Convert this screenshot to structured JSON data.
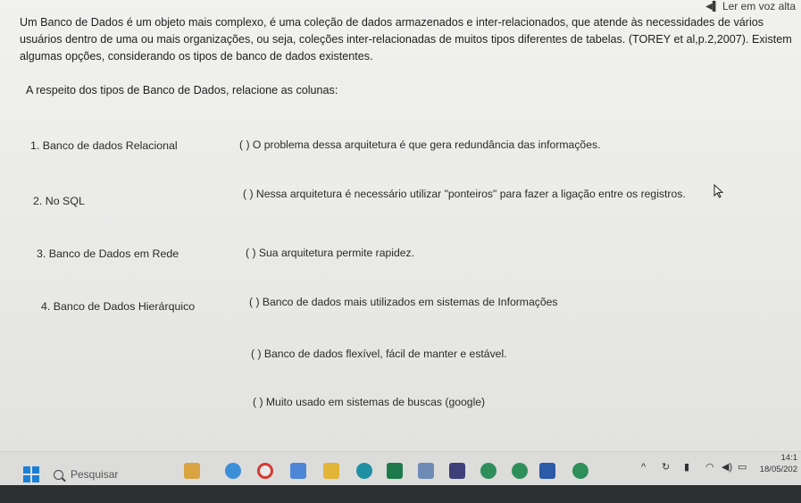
{
  "toolbar": {
    "read_aloud": "Ler em voz alta"
  },
  "question": {
    "intro": "Um Banco de Dados é um objeto mais complexo, é uma coleção de dados armazenados e inter-relacionados, que atende às necessidades de vários usuários dentro de uma ou mais organizações, ou seja, coleções inter-relacionadas de muitos tipos diferentes de tabelas. (TOREY et al,p.2,2007). Existem algumas opções, considerando os tipos de banco de dados existentes.",
    "prompt": "A respeito dos tipos de Banco de Dados, relacione as colunas:",
    "column_a": [
      "1.   Banco de dados Relacional",
      "2.   No SQL",
      "3.   Banco de Dados em Rede",
      "4.   Banco de Dados Hierárquico"
    ],
    "column_b": [
      "( ) O problema dessa arquitetura é que gera redundância das informações.",
      "(  ) Nessa arquitetura é necessário utilizar \"ponteiros\" para fazer a ligação entre os registros.",
      "(  ) Sua arquitetura permite rapidez.",
      "(  ) Banco de dados mais utilizados em sistemas de Informações",
      "(   ) Banco de dados flexível, fácil de manter e estável.",
      "(   ) Muito usado em sistemas de buscas (google)"
    ]
  },
  "taskbar": {
    "search_placeholder": "Pesquisar",
    "time": "14:1",
    "date": "18/05/202",
    "colors": {
      "start": "#1b7fd6",
      "bar": "#dcdcdb"
    },
    "icons": [
      "widgets-icon",
      "copilot-icon",
      "chrome-icon",
      "store-icon",
      "folder-icon",
      "edge-icon",
      "excel-icon",
      "photos-icon",
      "visio-icon",
      "chrome-profile-icon",
      "chrome-profile-icon-2",
      "word-icon",
      "chrome-icon-2"
    ]
  }
}
